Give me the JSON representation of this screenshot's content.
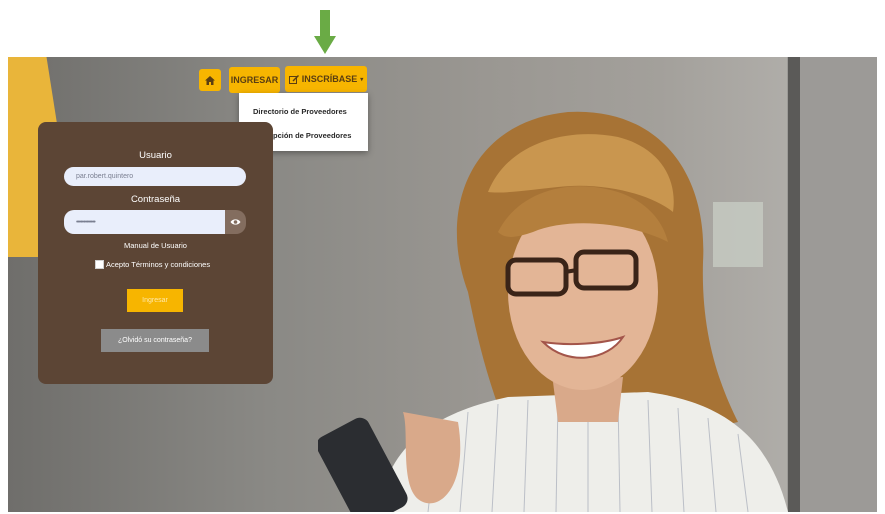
{
  "nav": {
    "ingresar_label": "INGRESAR",
    "inscribase_label": "INSCRÍBASE",
    "dropdown_items": [
      "Directorio de Proveedores",
      "Inscripción de Proveedores"
    ]
  },
  "login": {
    "usuario_label": "Usuario",
    "usuario_value": "par.robert.quintero",
    "password_label": "Contraseña",
    "password_value": "•••••••••••••",
    "manual_link": "Manual de Usuario",
    "terms_label": "Acepto Términos y condiciones",
    "submit_label": "Ingresar",
    "forgot_label": "¿Olvidó su contraseña?"
  },
  "colors": {
    "accent": "#f7b500",
    "card": "#5c4535",
    "arrow": "#6aab45"
  },
  "icons": [
    "home-icon",
    "edit-icon",
    "caret-down-icon",
    "eye-icon",
    "down-arrow-icon"
  ]
}
